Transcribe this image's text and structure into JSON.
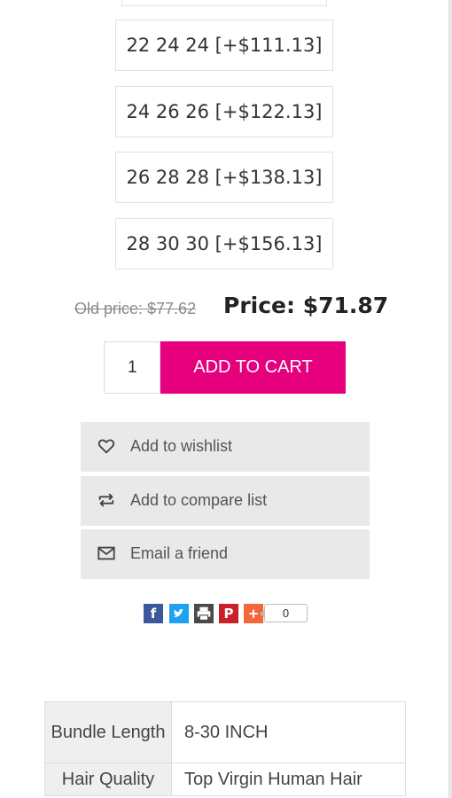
{
  "options": [
    {
      "label": "22 24 24 [+$111.13]"
    },
    {
      "label": "24 26 26 [+$122.13]"
    },
    {
      "label": "26 28 28 [+$138.13]"
    },
    {
      "label": "28 30 30 [+$156.13]"
    }
  ],
  "price": {
    "old": "Old price: $77.62",
    "current": "Price: $71.87"
  },
  "cart": {
    "quantity": "1",
    "add_label": "ADD TO CART",
    "accent_color": "#e6007e"
  },
  "actions": [
    {
      "label": "Add to wishlist",
      "icon": "heart-icon"
    },
    {
      "label": "Add to compare list",
      "icon": "compare-icon"
    },
    {
      "label": "Email a friend",
      "icon": "envelope-icon"
    }
  ],
  "share": {
    "icons": [
      "facebook-icon",
      "twitter-icon",
      "print-icon",
      "pinterest-icon",
      "plus-icon"
    ],
    "count": "0"
  },
  "specs": [
    {
      "name": "Bundle Length",
      "value": "8-30 INCH"
    },
    {
      "name": "Hair Quality",
      "value": "Top Virgin Human Hair"
    }
  ]
}
